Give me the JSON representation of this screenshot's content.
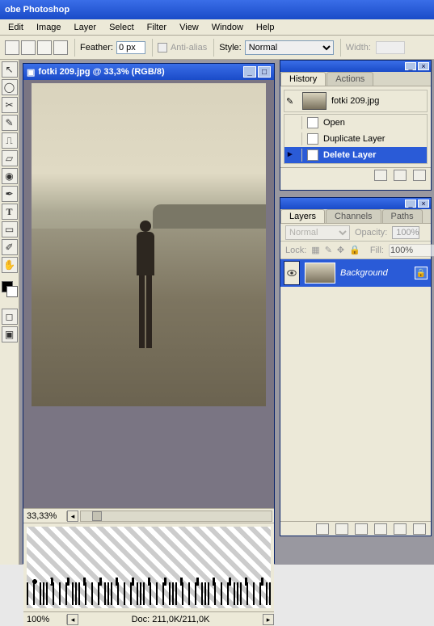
{
  "app": {
    "title": "obe Photoshop"
  },
  "menu": [
    "Edit",
    "Image",
    "Layer",
    "Select",
    "Filter",
    "View",
    "Window",
    "Help"
  ],
  "optbar": {
    "feather_label": "Feather:",
    "feather_value": "0 px",
    "antialias_label": "Anti-alias",
    "style_label": "Style:",
    "style_value": "Normal",
    "width_label": "Width:",
    "width_value": ""
  },
  "doc": {
    "title": "fotki 209.jpg @ 33,3% (RGB/8)",
    "zoom1": "33,33%",
    "zoom2": "100%",
    "doc_size": "Doc: 211,0K/211,0K"
  },
  "history": {
    "tabs": [
      "History",
      "Actions"
    ],
    "snapshot": "fotki 209.jpg",
    "rows": [
      {
        "label": "Open",
        "sel": false
      },
      {
        "label": "Duplicate Layer",
        "sel": false
      },
      {
        "label": "Delete Layer",
        "sel": true
      }
    ]
  },
  "layers": {
    "tabs": [
      "Layers",
      "Channels",
      "Paths"
    ],
    "blend": "Normal",
    "opacity_label": "Opacity:",
    "opacity": "100%",
    "lock_label": "Lock:",
    "fill_label": "Fill:",
    "fill": "100%",
    "rows": [
      {
        "name": "Background",
        "locked": true
      }
    ]
  }
}
